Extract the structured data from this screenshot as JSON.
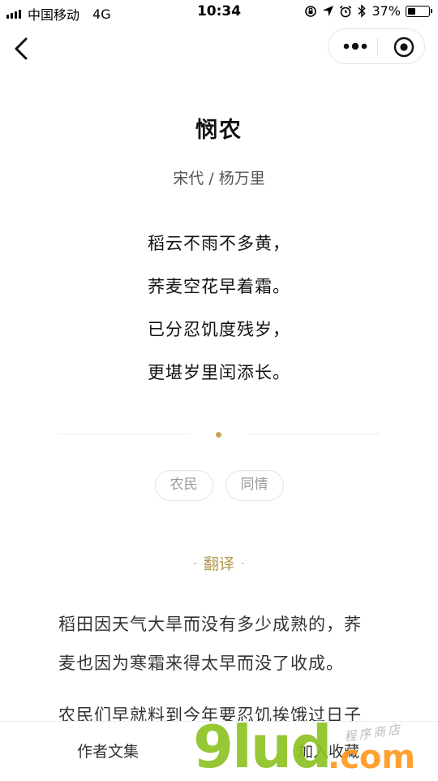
{
  "status_bar": {
    "carrier": "中国移动",
    "network": "4G",
    "time": "10:34",
    "battery_percent": "37%",
    "battery_level": 0.37
  },
  "nav": {
    "back_icon": "chevron-left-icon",
    "more_icon": "more-dots-icon",
    "close_icon": "target-close-icon"
  },
  "poem": {
    "title": "悯农",
    "author": "宋代 / 杨万里",
    "lines": [
      "稻云不雨不多黄，",
      "荞麦空花早着霜。",
      "已分忍饥度残岁，",
      "更堪岁里闰添长。"
    ]
  },
  "tags": [
    "农民",
    "同情"
  ],
  "translation": {
    "dot": "·",
    "title": "翻译",
    "lines": [
      "稻田因天气大旱而没有多少成熟的，荞",
      "麦也因为寒霜来得太早而没了收成。",
      "农民们早就料到今年要忍饥挨饿过日子"
    ]
  },
  "bottom_bar": {
    "author_works": "作者文集",
    "add_favorite": "加入收藏"
  },
  "watermark": {
    "logo": "9lud",
    "suffix": ".com",
    "chinese": "程序商店"
  },
  "colors": {
    "accent_gold": "#b7984e",
    "divider_dot": "#c4a65c",
    "tag_border": "#e3e3e3",
    "text_dark": "#111111"
  }
}
